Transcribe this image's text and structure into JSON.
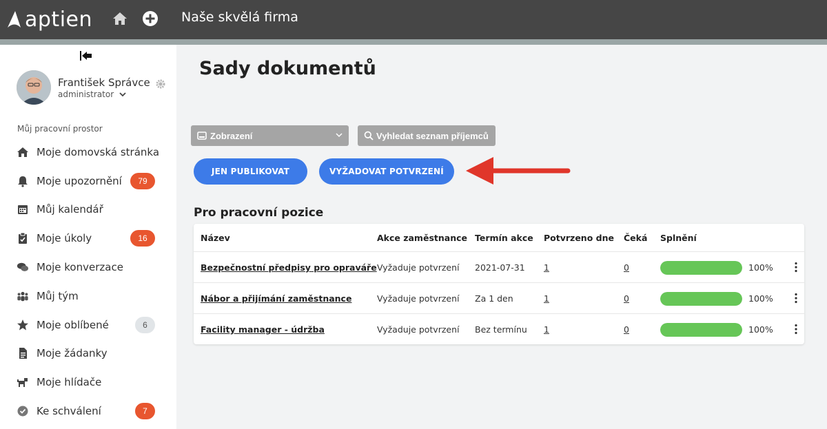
{
  "app": {
    "logo": "aptien",
    "company": "Naše skvělá firma"
  },
  "user": {
    "name": "František Správce",
    "role": "administrator"
  },
  "sidebar": {
    "section_label": "Můj pracovní prostor",
    "items": [
      {
        "label": "Moje domovská stránka",
        "icon": "home-icon"
      },
      {
        "label": "Moje upozornění",
        "icon": "bell-icon",
        "badge": "79"
      },
      {
        "label": "Můj kalendář",
        "icon": "calendar-icon"
      },
      {
        "label": "Moje úkoly",
        "icon": "clipboard-icon",
        "badge": "16"
      },
      {
        "label": "Moje konverzace",
        "icon": "chat-icon"
      },
      {
        "label": "Můj tým",
        "icon": "team-icon"
      },
      {
        "label": "Moje oblíbené",
        "icon": "star-icon",
        "badge": "6"
      },
      {
        "label": "Moje žádanky",
        "icon": "document-icon"
      },
      {
        "label": "Moje hlídače",
        "icon": "dog-icon"
      },
      {
        "label": "Ke schválení",
        "icon": "check-circle-icon",
        "badge": "7"
      }
    ]
  },
  "main": {
    "title": "Sady dokumentů",
    "view_select": "Zobrazení",
    "search_placeholder": "Vyhledat seznam příjemců",
    "btn_publish": "JEN PUBLIKOVAT",
    "btn_require": "VYŽADOVAT POTVRZENÍ",
    "section_title": "Pro pracovní pozice",
    "table": {
      "headers": [
        "Název",
        "Akce zaměstnance",
        "Termín akce",
        "Potvrzeno dne",
        "Čeká",
        "Splnění"
      ],
      "rows": [
        {
          "name": "Bezpečnostní předpisy pro opraváře",
          "action": "Vyžaduje potvrzení",
          "term": "2021-07-31",
          "confirmed": "1",
          "waiting": "0",
          "progress": 100,
          "progress_label": "100%"
        },
        {
          "name": "Nábor a přijímání zaměstnance",
          "action": "Vyžaduje potvrzení",
          "term": "Za 1 den",
          "confirmed": "1",
          "waiting": "0",
          "progress": 100,
          "progress_label": "100%"
        },
        {
          "name": "Facility manager - údržba",
          "action": "Vyžaduje potvrzení",
          "term": "Bez termínu",
          "confirmed": "1",
          "waiting": "0",
          "progress": 100,
          "progress_label": "100%"
        }
      ]
    }
  },
  "colors": {
    "topbar": "#464646",
    "primary": "#3d7be8",
    "badge": "#e8562f",
    "progress": "#66c657",
    "arrow": "#e0362a"
  }
}
